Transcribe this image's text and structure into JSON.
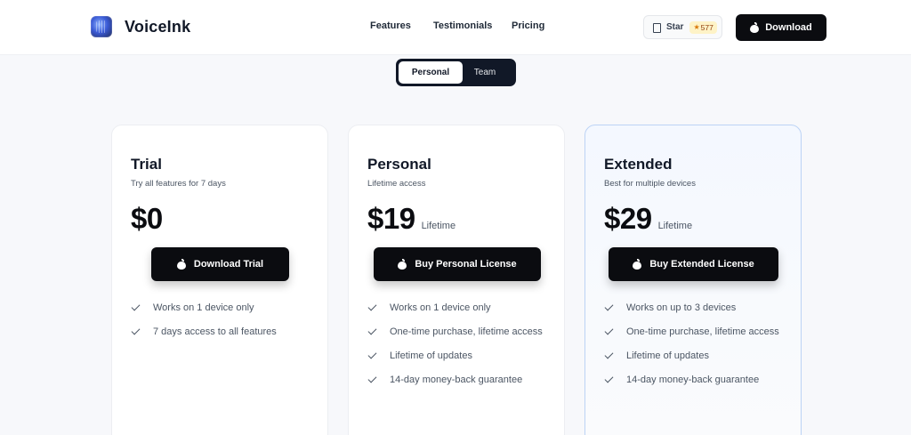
{
  "nav": {
    "brand": "VoiceInk",
    "links": [
      "Features",
      "Testimonials",
      "Pricing"
    ],
    "star_label": "Star",
    "star_count": "577",
    "download_label": "Download"
  },
  "toggle": {
    "options": [
      "Personal",
      "Team"
    ],
    "selected": "Personal"
  },
  "plans": [
    {
      "name": "Trial",
      "subtitle": "Try all features for 7 days",
      "price": "$0",
      "term": "",
      "button": "Download Trial",
      "features": [
        "Works on 1 device only",
        "7 days access to all features"
      ]
    },
    {
      "name": "Personal",
      "subtitle": "Lifetime access",
      "price": "$19",
      "term": "Lifetime",
      "button": "Buy Personal License",
      "features": [
        "Works on 1 device only",
        "One-time purchase, lifetime access",
        "Lifetime of updates",
        "14-day money-back guarantee"
      ]
    },
    {
      "name": "Extended",
      "subtitle": "Best for multiple devices",
      "price": "$29",
      "term": "Lifetime",
      "button": "Buy Extended License",
      "features": [
        "Works on up to 3 devices",
        "One-time purchase, lifetime access",
        "Lifetime of updates",
        "14-day money-back guarantee"
      ]
    }
  ],
  "colors": {
    "accent_dark": "#0b0c10",
    "highlight_border": "#bcd3f5",
    "star_badge": "#fef3c7"
  }
}
